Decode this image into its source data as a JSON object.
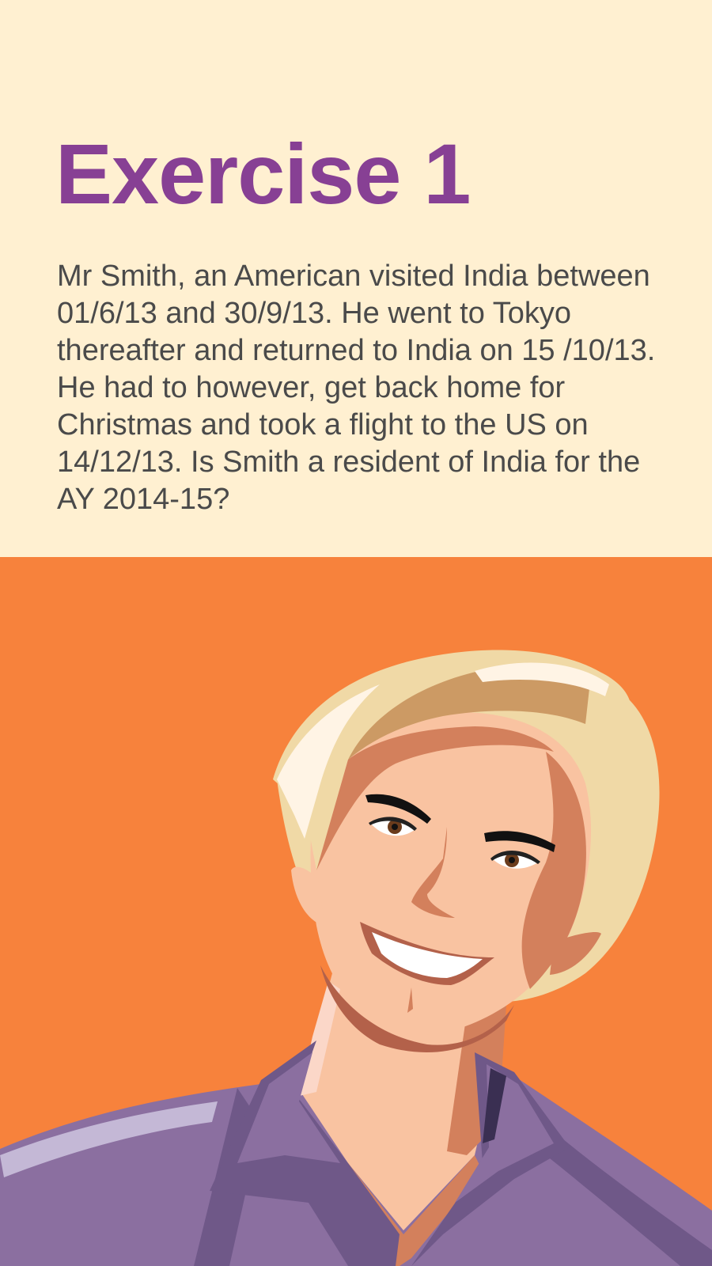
{
  "title": "Exercise 1",
  "question": "Mr Smith, an American visited India between 01/6/13 and 30/9/13. He went to Tokyo thereafter and returned to India on 15 /10/13. He had to however, get back home for Christmas and took a flight to the US on 14/12/13. Is Smith a resident of India for the AY 2014-15?",
  "colors": {
    "top_background": "#fff0d1",
    "bottom_background": "#f7823c",
    "title": "#874094",
    "text": "#4a4a4a"
  },
  "illustration": {
    "icon": "smiling-man-illustration"
  }
}
